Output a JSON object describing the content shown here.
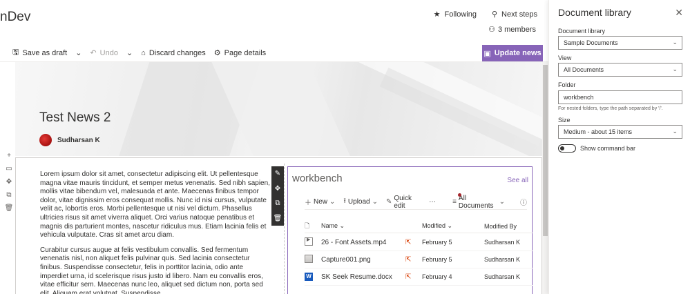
{
  "site": {
    "title": "nDev"
  },
  "top_actions": {
    "following": "Following",
    "next_steps": "Next steps",
    "members": "3 members"
  },
  "toolbar": {
    "save_draft": "Save as draft",
    "undo": "Undo",
    "discard": "Discard changes",
    "page_details": "Page details",
    "update_news": "Update news"
  },
  "hero": {
    "title": "Test News 2",
    "author": "Sudharsan K"
  },
  "text": {
    "p1": "Lorem ipsum dolor sit amet, consectetur adipiscing elit. Ut pellentesque magna vitae mauris tincidunt, et semper metus venenatis. Sed nibh sapien, mollis vitae bibendum vel, malesuada et ante. Maecenas finibus tempor dolor, vitae dignissim eros consequat mollis. Nunc id nisi cursus, vulputate velit ac, lobortis eros. Morbi pellentesque ut nisi vel dictum. Phasellus ultricies risus sit amet viverra aliquet. Orci varius natoque penatibus et magnis dis parturient montes, nascetur ridiculus mus. Etiam lacinia felis et vehicula vulputate. Cras sit amet arcu diam.",
    "p2": "Curabitur cursus augue at felis vestibulum convallis. Sed fermentum venenatis nisl, non aliquet felis pulvinar quis. Sed lacinia consectetur finibus. Suspendisse consectetur, felis in porttitor lacinia, odio ante imperdiet urna, id scelerisque risus justo id libero. Nam eu convallis eros, vitae efficitur sem. Maecenas nunc leo, aliquet sed dictum non, porta sed elit. Aliquam erat volutpat. Suspendisse"
  },
  "webpart": {
    "title": "workbench",
    "see_all": "See all",
    "commands": {
      "new": "New",
      "upload": "Upload",
      "quick_edit": "Quick edit",
      "more": "···",
      "view": "All Documents"
    },
    "columns": {
      "name": "Name",
      "modified": "Modified",
      "modified_by": "Modified By"
    },
    "rows": [
      {
        "name": "26 - Font Assets.mp4",
        "modified": "February 5",
        "modified_by": "Sudharsan K",
        "type": "video"
      },
      {
        "name": "Capture001.png",
        "modified": "February 5",
        "modified_by": "Sudharsan K",
        "type": "image"
      },
      {
        "name": "SK Seek Resume.docx",
        "modified": "February 4",
        "modified_by": "Sudharsan K",
        "type": "word"
      }
    ]
  },
  "panel": {
    "title": "Document library",
    "library_label": "Document library",
    "library_value": "Sample Documents",
    "view_label": "View",
    "view_value": "All Documents",
    "folder_label": "Folder",
    "folder_value": "workbench",
    "folder_hint": "For nested folders, type the path separated by '/'.",
    "size_label": "Size",
    "size_value": "Medium - about 15 items",
    "toggle_label": "Show command bar"
  },
  "colors": {
    "accent": "#8764b8",
    "text": "#323130",
    "share": "#d83b01"
  }
}
